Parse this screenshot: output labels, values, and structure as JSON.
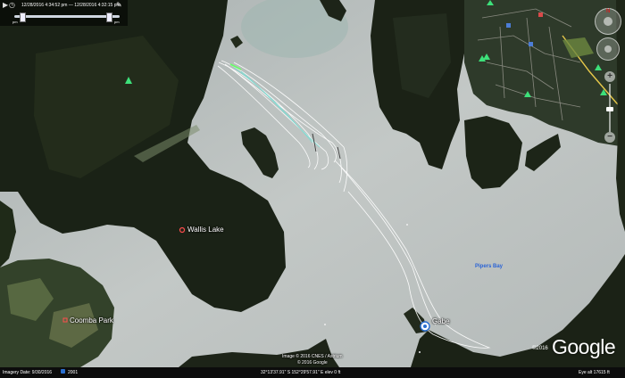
{
  "time_slider": {
    "start_datetime": "12/28/2016 4:34:52 pm",
    "end_datetime": "12/28/2016 4:32:15 pm",
    "range_separator": "—",
    "start_label": "pm",
    "end_label": "pm",
    "selection": [
      0.08,
      0.9
    ]
  },
  "places": [
    {
      "name": "Wallis Lake"
    },
    {
      "name": "Coomba Park"
    },
    {
      "name": "Gabe"
    }
  ],
  "water_labels": [
    {
      "name": "Pipers Bay"
    }
  ],
  "copyright": {
    "line1": "Image © 2016 CNES / Astrium",
    "line2": "© 2016 Google"
  },
  "logo": {
    "text": "Google",
    "year": "©2016"
  },
  "status_bar": {
    "imagery_date": "Imagery Date: 9/30/2016",
    "year": "2001",
    "coordinates": "32°13'37.91\" S  152°29'57.91\" E  elev   0 ft",
    "eye_alt": "Eye alt   17615 ft"
  },
  "colors": {
    "water": "#b9bfbf",
    "forest": "#1c2317",
    "track": "#ffffff",
    "track_highlight": "#7fdcd3",
    "water_label": "#2a63d6"
  },
  "icons": [
    "tree-icon",
    "place-marker-icon",
    "gps-pin-icon",
    "compass-icon",
    "look-joystick-icon",
    "zoom-slider-icon",
    "play-icon",
    "wrench-icon"
  ]
}
